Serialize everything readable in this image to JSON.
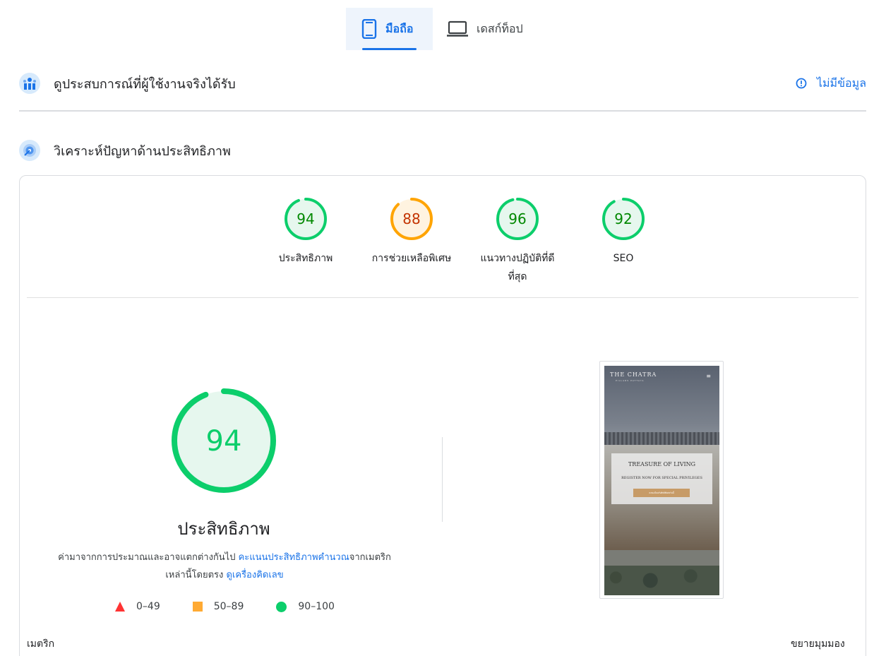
{
  "tabs": [
    {
      "label": "มือถือ",
      "icon": "smartphone-icon",
      "active": true
    },
    {
      "label": "เดสก์ท็อป",
      "icon": "laptop-icon",
      "active": false
    }
  ],
  "field_data": {
    "title": "ดูประสบการณ์ที่ผู้ใช้งานจริงได้รับ",
    "status": "ไม่มีข้อมูล"
  },
  "diagnose": {
    "title": "วิเคราะห์ปัญหาด้านประสิทธิภาพ"
  },
  "scores": [
    {
      "label": "ประสิทธิภาพ",
      "value": "94",
      "color": "#0cce6b",
      "bg": "#e6f7ee",
      "text": "#008800"
    },
    {
      "label": "การช่วยเหลือพิเศษ",
      "value": "88",
      "color": "#ffa400",
      "bg": "#fff3e0",
      "text": "#c33300"
    },
    {
      "label": "แนวทางปฏิบัติที่ดีที่สุด",
      "value": "96",
      "color": "#0cce6b",
      "bg": "#e6f7ee",
      "text": "#008800"
    },
    {
      "label": "SEO",
      "value": "92",
      "color": "#0cce6b",
      "bg": "#e6f7ee",
      "text": "#008800"
    }
  ],
  "main_score": {
    "value": "94",
    "title": "ประสิทธิภาพ",
    "desc_prefix": "ค่ามาจากการประมาณและอาจแตกต่างกันไป ",
    "desc_link1": "คะแนนประสิทธิภาพคำนวณ",
    "desc_mid": "จากเมตริกเหล่านี้โดยตรง ",
    "desc_link2": "ดูเครื่องคิดเลข"
  },
  "legend": [
    {
      "range": "0–49",
      "shape": "triangle",
      "color": "#ff3333"
    },
    {
      "range": "50–89",
      "shape": "square",
      "color": "#ffaa33"
    },
    {
      "range": "90–100",
      "shape": "circle",
      "color": "#0cce6b"
    }
  ],
  "screenshot": {
    "brand": "THE CHATRA",
    "brand_sub": "PILLARS PATTAYA",
    "headline": "TREASURE OF LIVING",
    "subheadline": "REGISTER NOW FOR SPECIAL PRIVILEGES",
    "button": "ลงทะเบียนรับสิทธิพิเศษวันนี้"
  },
  "footer": {
    "metrics_label": "เมตริก",
    "expand_label": "ขยายมุมมอง"
  }
}
